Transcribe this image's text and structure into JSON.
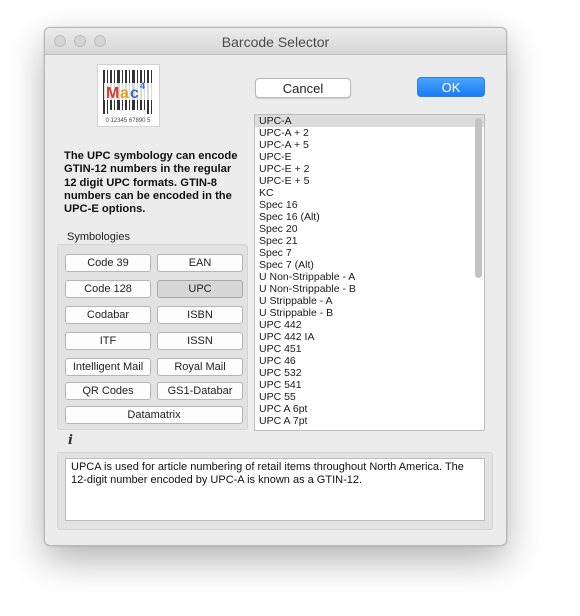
{
  "window": {
    "title": "Barcode Selector"
  },
  "logo": {
    "text": "Mac",
    "barcode_digits": "0 12345 67890 5"
  },
  "buttons": {
    "cancel": "Cancel",
    "ok": "OK"
  },
  "description": "The UPC symbology can encode GTIN-12 numbers in the regular 12 digit UPC formats. GTIN-8 numbers can be encoded in the UPC-E options.",
  "symbologies": {
    "label": "Symbologies",
    "selected": "UPC",
    "buttons": [
      "Code 39",
      "EAN",
      "Code 128",
      "UPC",
      "Codabar",
      "ISBN",
      "ITF",
      "ISSN",
      "Intelligent Mail",
      "Royal Mail",
      "QR Codes",
      "GS1-Databar",
      "Datamatrix"
    ]
  },
  "list": {
    "selected": "UPC-A",
    "items": [
      "UPC-A",
      "UPC-A + 2",
      "UPC-A + 5",
      "UPC-E",
      "UPC-E + 2",
      "UPC-E + 5",
      "KC",
      "Spec 16",
      "Spec 16 (Alt)",
      "Spec 20",
      "Spec 21",
      "Spec 7",
      "Spec 7 (Alt)",
      "U Non-Strippable - A",
      "U Non-Strippable - B",
      "U Strippable - A",
      "U Strippable - B",
      "UPC 442",
      "UPC 442 IA",
      "UPC 451",
      "UPC 46",
      "UPC 532",
      "UPC 541",
      "UPC 55",
      "UPC A 6pt",
      "UPC A 7pt"
    ]
  },
  "info": {
    "icon": "i",
    "text": "UPCA is used for article numbering of retail items throughout North America. The 12-digit number encoded by UPC-A is known as a GTIN-12."
  },
  "colors": {
    "accent": "#1a7cf4",
    "window_bg": "#ececec",
    "selection": "#dcdcdc"
  }
}
